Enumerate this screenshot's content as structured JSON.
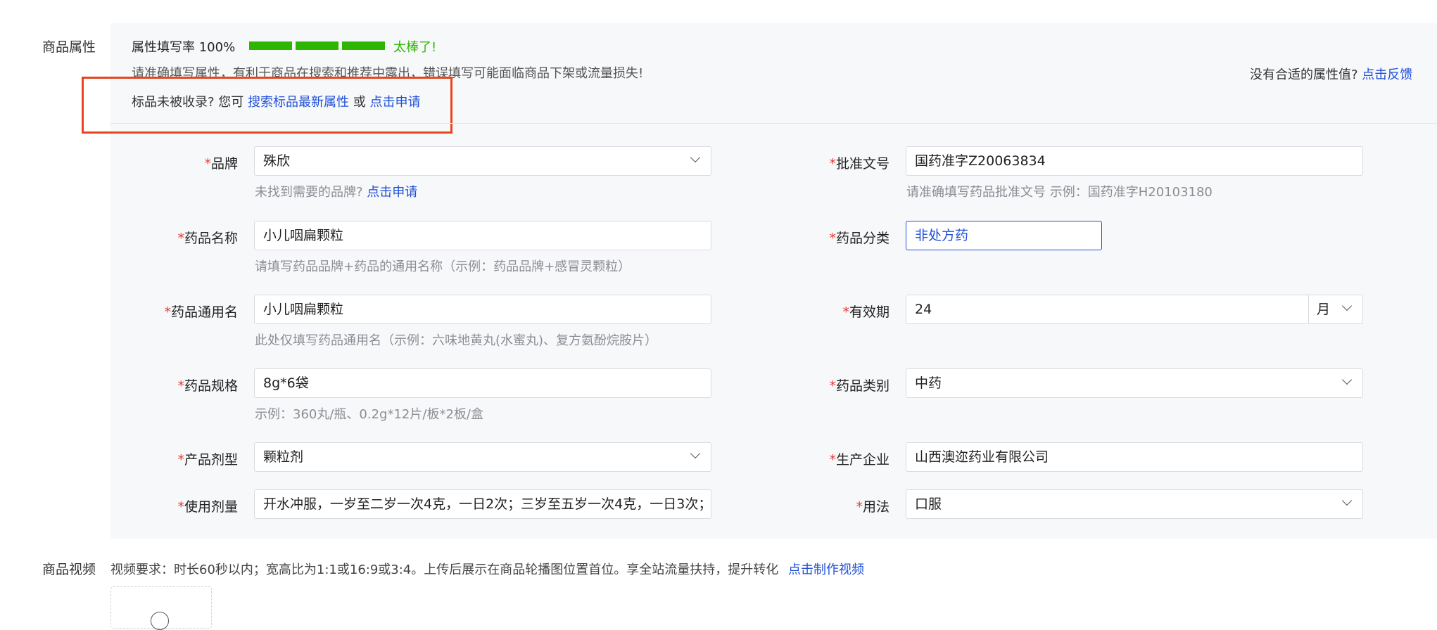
{
  "attributes": {
    "section_label": "商品属性",
    "fill_rate_label": "属性填写率 100%",
    "fill_rate_value": 1.0,
    "great_text": "太棒了!",
    "warning_text": "请准确填写属性，有利于商品在搜索和推荐中露出，错误填写可能面临商品下架或流量损失!",
    "no_suitable_text": "没有合适的属性值?",
    "feedback_link": "点击反馈",
    "not_indexed_text": "标品未被收录? 您可",
    "search_link": "搜索标品最新属性",
    "or_text": "或",
    "apply_link": "点击申请",
    "colors": {
      "success": "#2db600",
      "link": "#1f4fd8",
      "required": "#e53935",
      "highlight": "#e8451e"
    }
  },
  "fields": {
    "brand": {
      "label": "品牌",
      "value": "殊欣",
      "hint_text": "未找到需要的品牌?",
      "hint_link": "点击申请"
    },
    "approval_no": {
      "label": "批准文号",
      "value": "国药准字Z20063834",
      "hint": "请准确填写药品批准文号 示例：国药准字H20103180"
    },
    "drug_name": {
      "label": "药品名称",
      "value": "小儿咽扁颗粒",
      "hint": "请填写药品品牌+药品的通用名称（示例：药品品牌+感冒灵颗粒）"
    },
    "drug_category": {
      "label": "药品分类",
      "value": "非处方药"
    },
    "generic_name": {
      "label": "药品通用名",
      "value": "小儿咽扁颗粒",
      "hint": "此处仅填写药品通用名（示例：六味地黄丸(水蜜丸)、复方氨酚烷胺片）"
    },
    "validity": {
      "label": "有效期",
      "value": "24",
      "unit": "月"
    },
    "spec": {
      "label": "药品规格",
      "value": "8g*6袋",
      "hint": "示例：360丸/瓶、0.2g*12片/板*2板/盒"
    },
    "drug_type": {
      "label": "药品类别",
      "value": "中药"
    },
    "dosage_form": {
      "label": "产品剂型",
      "value": "颗粒剂"
    },
    "manufacturer": {
      "label": "生产企业",
      "value": "山西澳迩药业有限公司"
    },
    "dosage": {
      "label": "使用剂量",
      "value": "开水冲服，一岁至二岁一次4克，一日2次；三岁至五岁一次4克，一日3次；"
    },
    "usage": {
      "label": "用法",
      "value": "口服"
    }
  },
  "video": {
    "section_label": "商品视频",
    "requirement_text": "视频要求：时长60秒以内；宽高比为1:1或16:9或3:4。上传后展示在商品轮播图位置首位。享全站流量扶持，提升转化",
    "make_video_link": "点击制作视频"
  }
}
